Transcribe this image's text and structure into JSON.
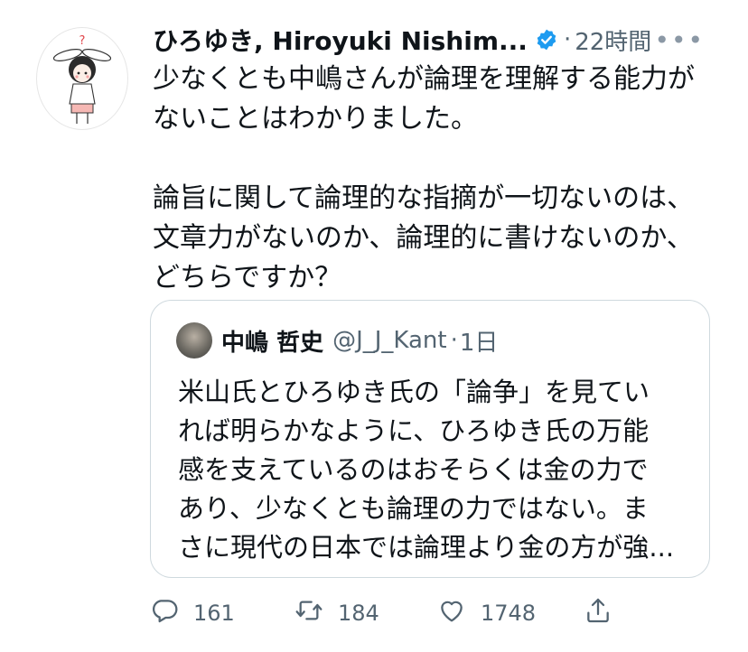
{
  "tweet": {
    "author_name": "ひろゆき, Hiroyuki Nishim...",
    "separator": "·",
    "time": "22時間",
    "more_icon": "more-dots-icon",
    "verified_icon": "verified-badge-icon",
    "paragraph1_line1": "少なくとも中嶋さんが論理を理解する能力が",
    "paragraph1_line2": "ないことはわかりました。",
    "paragraph2_line1": "論旨に関して論理的な指摘が一切ないのは、",
    "paragraph2_line2": "文章力がないのか、論理的に書けないのか、",
    "paragraph2_line3": "どちらですか？"
  },
  "quote": {
    "author_name": "中嶋 哲史",
    "handle": "@J_J_Kant",
    "separator": "·",
    "time": "1日",
    "line1": "米山氏とひろゆき氏の「論争」を見てい",
    "line2": "れば明らかなように、ひろゆき氏の万能",
    "line3": "感を支えているのはおそらくは金の力で",
    "line4": "あり、少なくとも論理の力ではない。ま",
    "line5": "さに現代の日本では論理より金の方が強..."
  },
  "actions": {
    "reply_count": "161",
    "retweet_count": "184",
    "like_count": "1748",
    "reply_icon": "reply-icon",
    "retweet_icon": "retweet-icon",
    "like_icon": "heart-icon",
    "share_icon": "share-icon"
  },
  "colors": {
    "text": "#0f1419",
    "secondary": "#536471",
    "verified": "#1d9bf0",
    "border": "#cfd9de"
  }
}
